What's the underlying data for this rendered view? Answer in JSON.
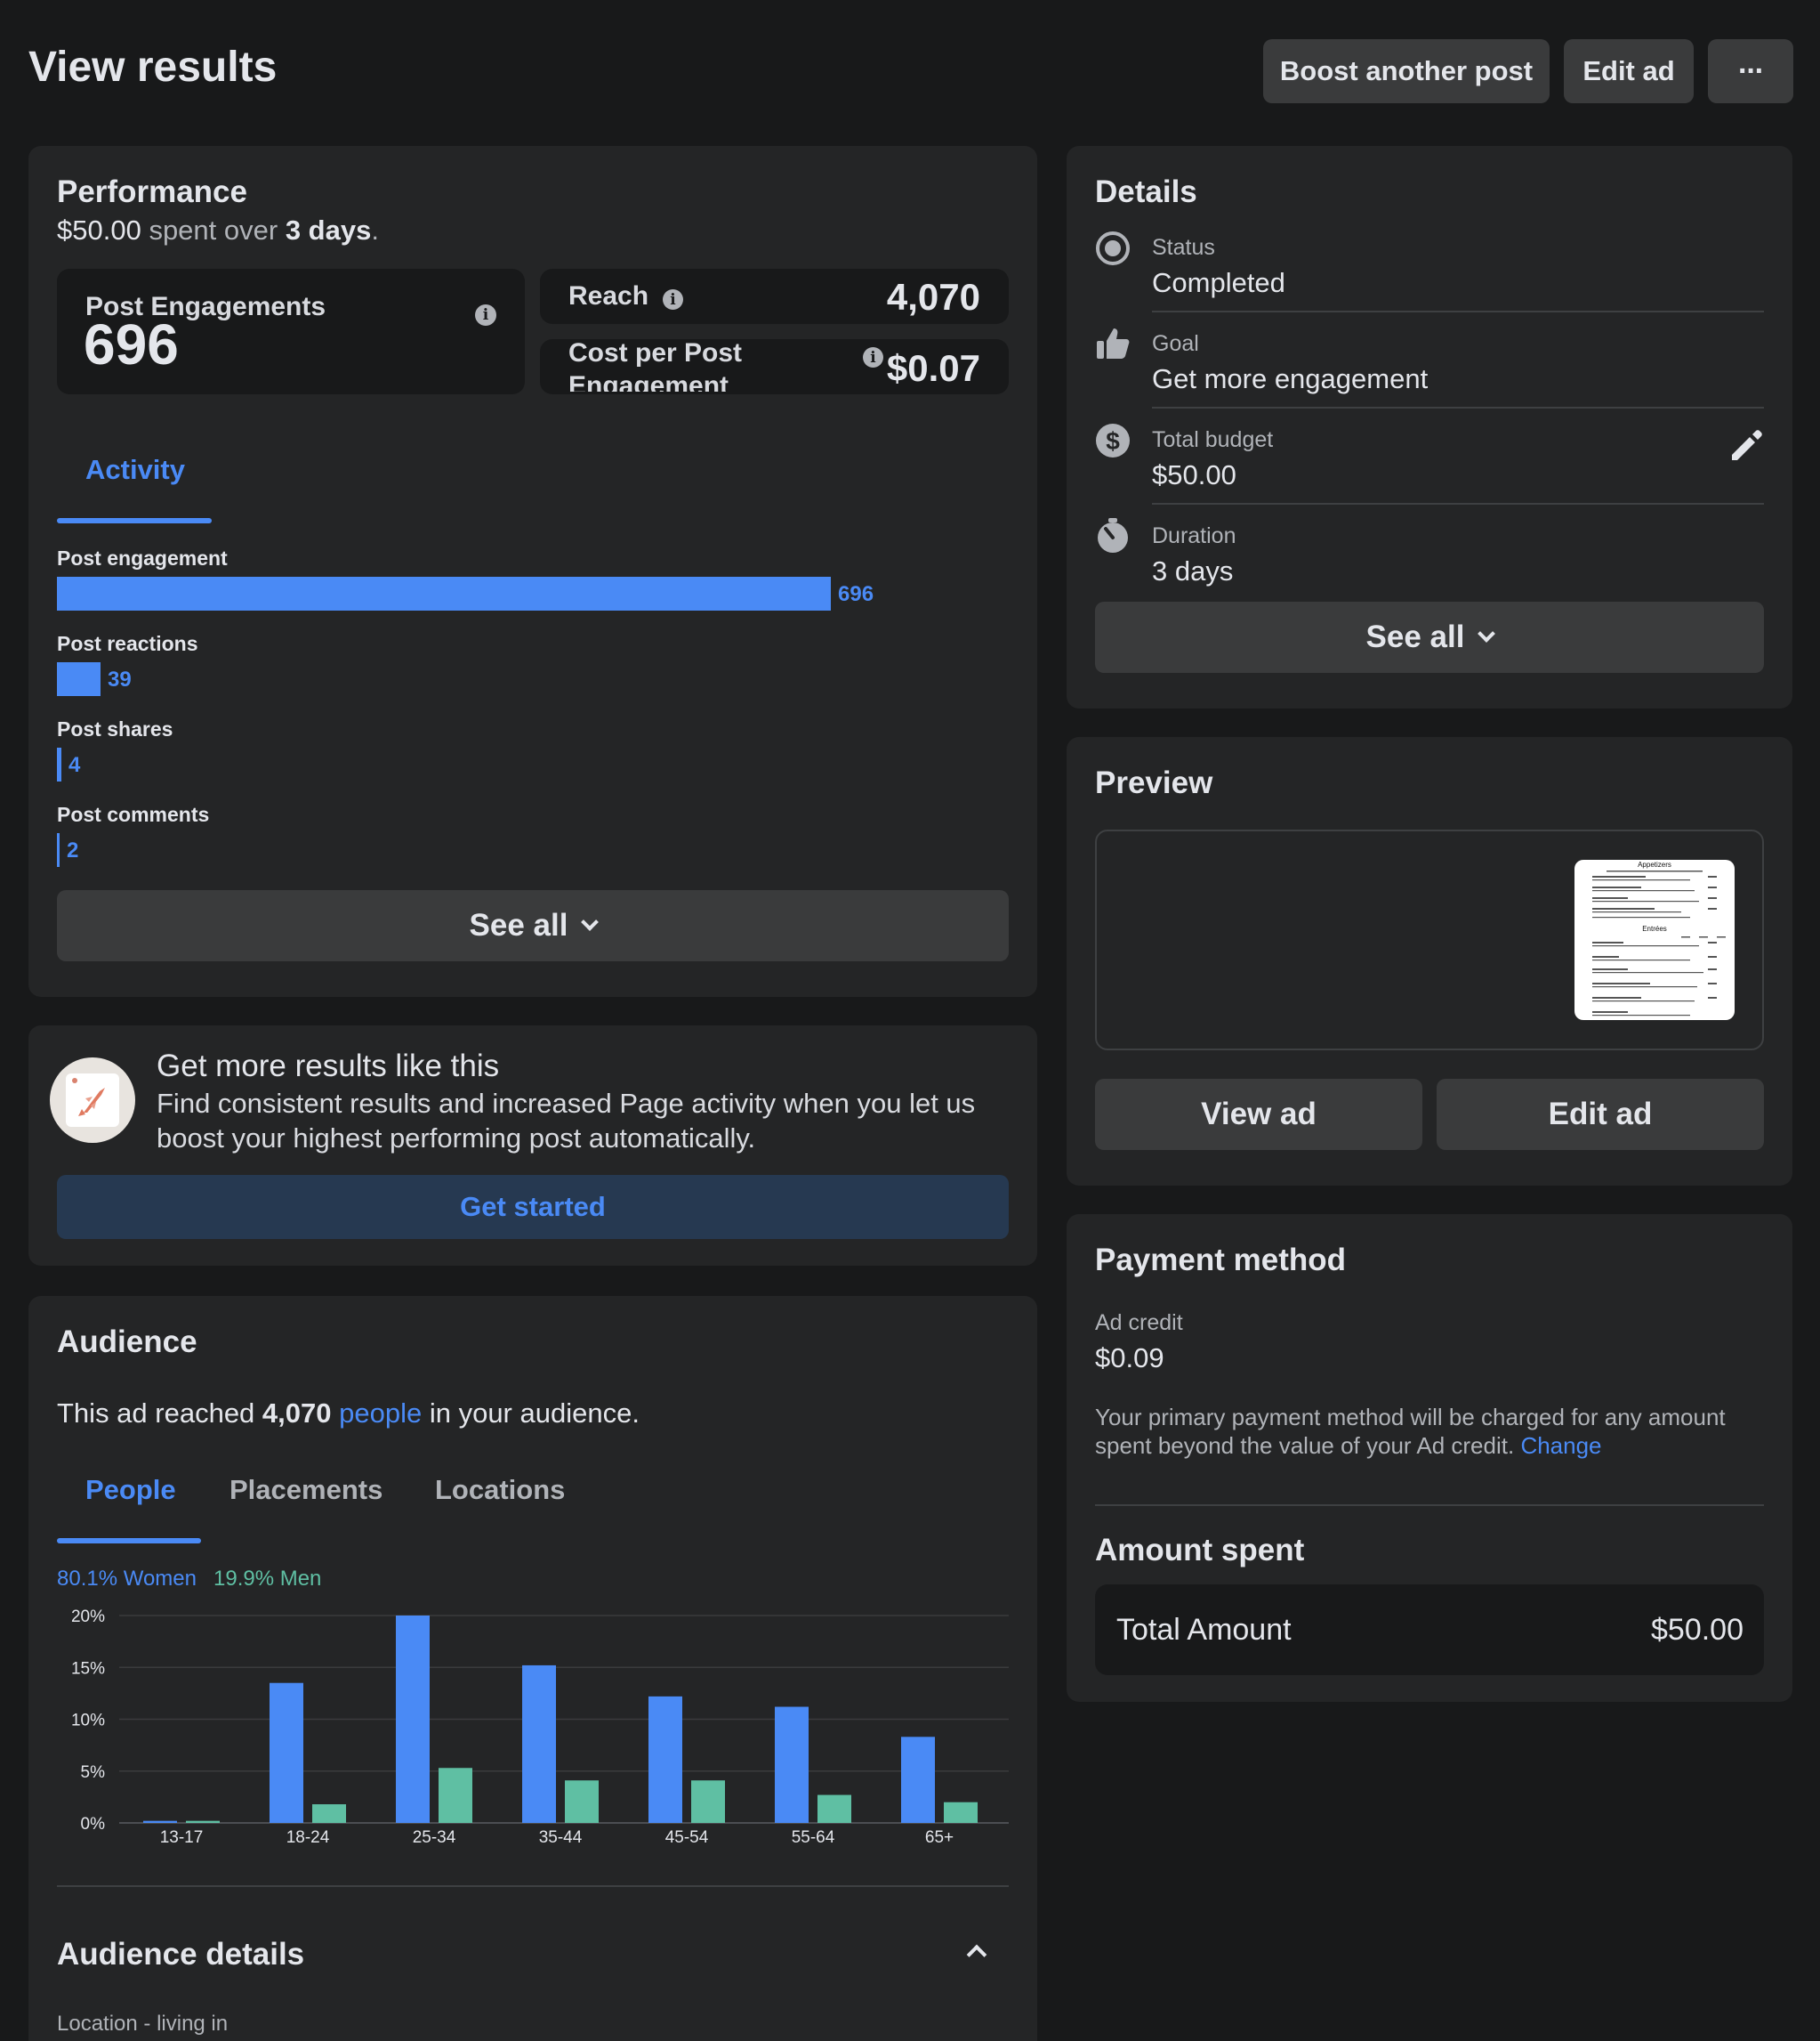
{
  "header": {
    "title": "View results",
    "boost_label": "Boost another post",
    "edit_label": "Edit ad",
    "more_label": "···"
  },
  "performance": {
    "title": "Performance",
    "spent": "$50.00",
    "spent_mid": " spent over ",
    "days": "3 days",
    "period": ".",
    "post_engagements_label": "Post Engagements",
    "post_engagements_value": "696",
    "reach_label": "Reach",
    "reach_value": "4,070",
    "cpe_label": "Cost per Post Engagement",
    "cpe_value": "$0.07",
    "info_glyph": "i",
    "tab_activity": "Activity",
    "activity": [
      {
        "label": "Post engagement",
        "value": "696",
        "amount": 696
      },
      {
        "label": "Post reactions",
        "value": "39",
        "amount": 39
      },
      {
        "label": "Post shares",
        "value": "4",
        "amount": 4
      },
      {
        "label": "Post comments",
        "value": "2",
        "amount": 2
      }
    ],
    "see_all": "See all"
  },
  "promo": {
    "title": "Get more results like this",
    "body": "Find consistent results and increased Page activity when you let us boost your highest performing post automatically.",
    "cta": "Get started"
  },
  "audience": {
    "title": "Audience",
    "summary_pre": "This ad reached ",
    "summary_count": "4,070",
    "summary_link": "people",
    "summary_post": " in your audience.",
    "tabs": [
      "People",
      "Placements",
      "Locations"
    ],
    "women_label": "80.1% Women",
    "men_label": "19.9% Men",
    "details_title": "Audience details",
    "location_label": "Location - living in"
  },
  "chart_data": {
    "type": "bar",
    "categories": [
      "13-17",
      "18-24",
      "25-34",
      "35-44",
      "45-54",
      "55-64",
      "65+"
    ],
    "series": [
      {
        "name": "Women",
        "values": [
          0.2,
          13.5,
          20,
          15.2,
          12.2,
          11.2,
          8.3
        ]
      },
      {
        "name": "Men",
        "values": [
          0.2,
          1.8,
          5.3,
          4.1,
          4.1,
          2.7,
          2.0
        ]
      }
    ],
    "yticks": [
      "0%",
      "5%",
      "10%",
      "15%",
      "20%"
    ],
    "ylim": [
      0,
      20
    ],
    "colors": {
      "Women": "#4a8af5",
      "Men": "#5fbfa3"
    },
    "grid": true
  },
  "details": {
    "title": "Details",
    "items": [
      {
        "label": "Status",
        "value": "Completed",
        "icon": "status-radio-icon"
      },
      {
        "label": "Goal",
        "value": "Get more engagement",
        "icon": "thumbs-up-icon"
      },
      {
        "label": "Total budget",
        "value": "$50.00",
        "icon": "dollar-icon"
      },
      {
        "label": "Duration",
        "value": "3 days",
        "icon": "stopwatch-icon"
      }
    ],
    "see_all": "See all"
  },
  "preview": {
    "title": "Preview",
    "view_ad": "View ad",
    "edit_ad": "Edit ad",
    "menu_heading": "Appetizers",
    "menu_section": "Entrées"
  },
  "payment": {
    "title": "Payment method",
    "credit_label": "Ad credit",
    "credit_value": "$0.09",
    "note": "Your primary payment method will be charged for any amount spent beyond the value of your Ad credit.",
    "change_link": "Change",
    "amount_title": "Amount spent",
    "total_label": "Total Amount",
    "total_value": "$50.00"
  }
}
